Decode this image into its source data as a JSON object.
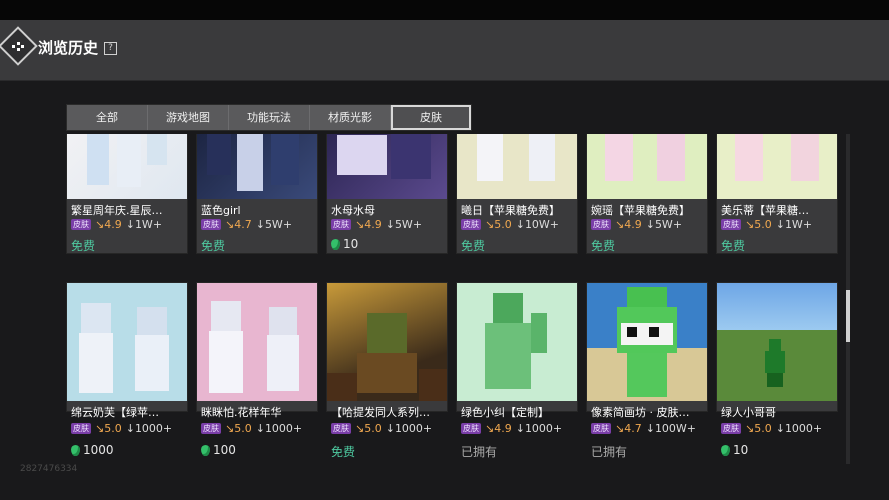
{
  "header": {
    "title": "浏览历史",
    "help_icon": "?"
  },
  "tabs": [
    {
      "label": "全部",
      "active": false
    },
    {
      "label": "游戏地图",
      "active": false
    },
    {
      "label": "功能玩法",
      "active": false
    },
    {
      "label": "材质光影",
      "active": false
    },
    {
      "label": "皮肤",
      "active": true
    }
  ],
  "badge_label": "皮肤",
  "cards_row1": [
    {
      "name": "繁星周年庆.星辰…",
      "rating": "4.9",
      "downloads": "1W+",
      "price": "免费",
      "price_type": "free"
    },
    {
      "name": "蓝色girl",
      "rating": "4.7",
      "downloads": "5W+",
      "price": "免费",
      "price_type": "free"
    },
    {
      "name": "水母水母",
      "rating": "4.9",
      "downloads": "5W+",
      "price": "10",
      "price_type": "gem"
    },
    {
      "name": "曦日【苹果糖免费】",
      "rating": "5.0",
      "downloads": "10W+",
      "price": "免费",
      "price_type": "free"
    },
    {
      "name": "婉瑶【苹果糖免费】",
      "rating": "4.9",
      "downloads": "5W+",
      "price": "免费",
      "price_type": "free"
    },
    {
      "name": "美乐蒂【苹果糖…",
      "rating": "5.0",
      "downloads": "1W+",
      "price": "免费",
      "price_type": "free"
    }
  ],
  "cards_row2": [
    {
      "name": "绵云奶芙【绿苹…",
      "rating": "5.0",
      "downloads": "1000+",
      "price": "1000",
      "price_type": "gem"
    },
    {
      "name": "眯眯怕.花样年华",
      "rating": "5.0",
      "downloads": "1000+",
      "price": "100",
      "price_type": "gem"
    },
    {
      "name": "【哈提发同人系列…",
      "rating": "5.0",
      "downloads": "1000+",
      "price": "免费",
      "price_type": "free"
    },
    {
      "name": "绿色小纠【定制】",
      "rating": "4.9",
      "downloads": "1000+",
      "price": "已拥有",
      "price_type": "owned"
    },
    {
      "name": "像素简画坊 · 皮肤…",
      "rating": "4.7",
      "downloads": "100W+",
      "price": "已拥有",
      "price_type": "owned"
    },
    {
      "name": "绿人小哥哥",
      "rating": "5.0",
      "downloads": "1000+",
      "price": "10",
      "price_type": "gem"
    }
  ],
  "watermark": "2827476334",
  "colors": {
    "free": "#4ec9a0",
    "badge": "#7a3ea8",
    "rating": "#f0a850",
    "gem": "#34c06a"
  }
}
